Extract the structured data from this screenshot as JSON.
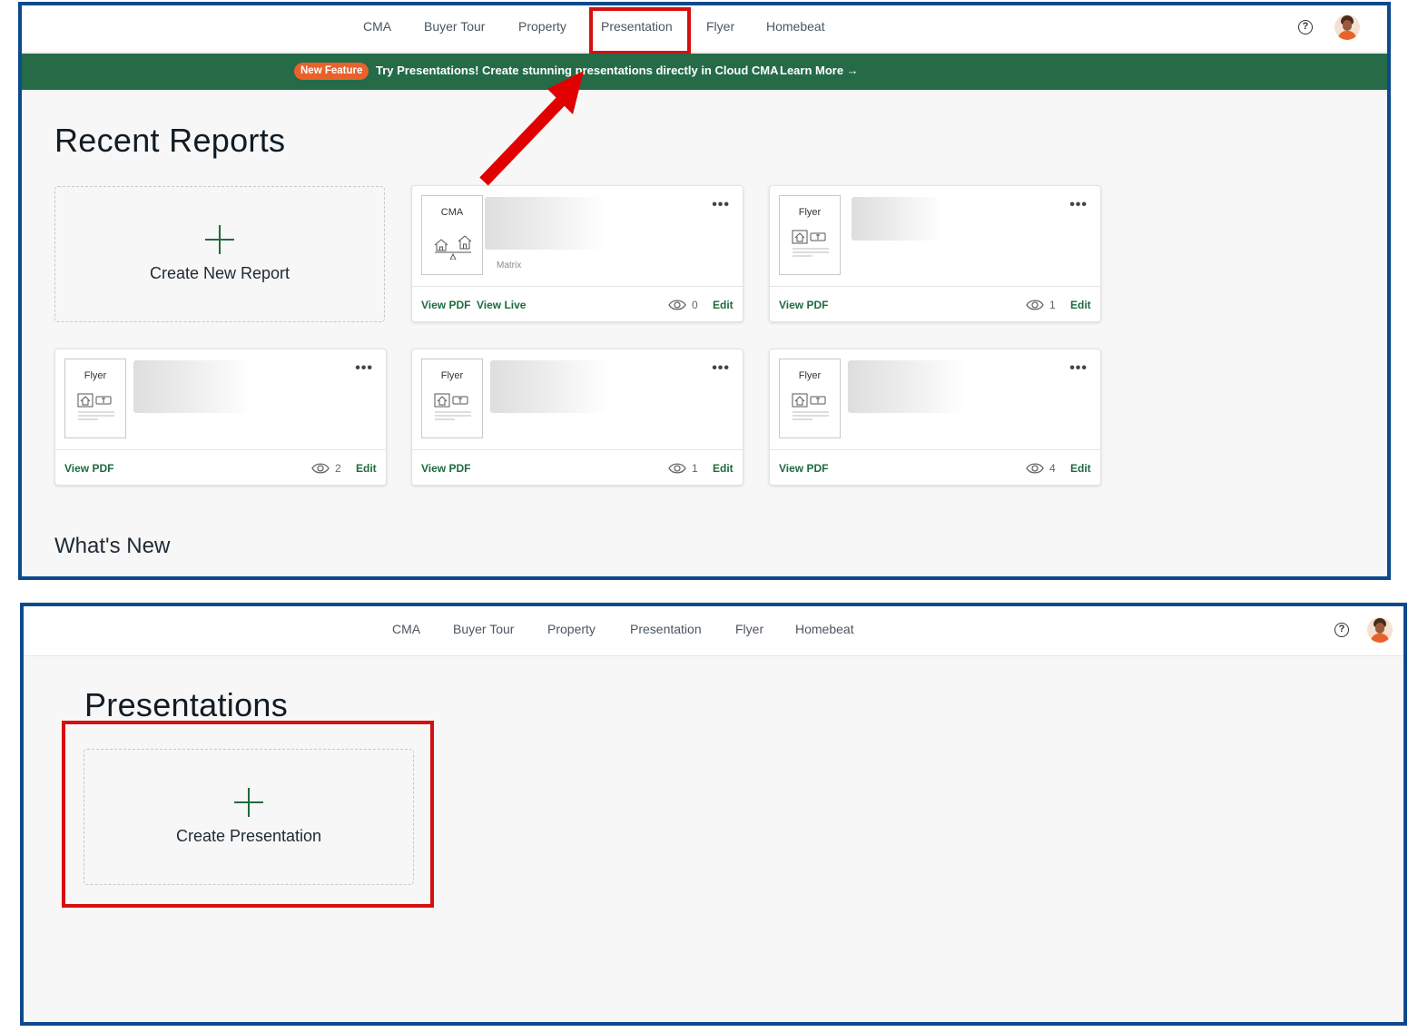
{
  "nav": {
    "items": [
      "CMA",
      "Buyer Tour",
      "Property",
      "Presentation",
      "Flyer",
      "Homebeat"
    ],
    "help_icon": "question-circle-icon"
  },
  "banner": {
    "badge": "New Feature",
    "text": "Try Presentations! Create stunning presentations directly in Cloud CMA",
    "link": "Learn More →",
    "color": "#256b48"
  },
  "recent": {
    "title": "Recent Reports",
    "create_label": "Create New Report",
    "cards": [
      {
        "type": "CMA",
        "subtitle": "Matrix",
        "links": [
          "View PDF",
          "View Live"
        ],
        "views": "0",
        "edit": "Edit"
      },
      {
        "type": "Flyer",
        "subtitle": "",
        "links": [
          "View PDF"
        ],
        "views": "1",
        "edit": "Edit"
      },
      {
        "type": "Flyer",
        "subtitle": "",
        "links": [
          "View PDF"
        ],
        "views": "2",
        "edit": "Edit"
      },
      {
        "type": "Flyer",
        "subtitle": "",
        "links": [
          "View PDF"
        ],
        "views": "1",
        "edit": "Edit"
      },
      {
        "type": "Flyer",
        "subtitle": "",
        "links": [
          "View PDF"
        ],
        "views": "4",
        "edit": "Edit"
      }
    ]
  },
  "whats_new": {
    "title": "What's New"
  },
  "presentations": {
    "title": "Presentations",
    "create_label": "Create Presentation"
  },
  "colors": {
    "accent": "#1e6b3e",
    "frame": "#0d4a8c",
    "highlight": "#d60f0f",
    "badge": "#e8622b"
  }
}
